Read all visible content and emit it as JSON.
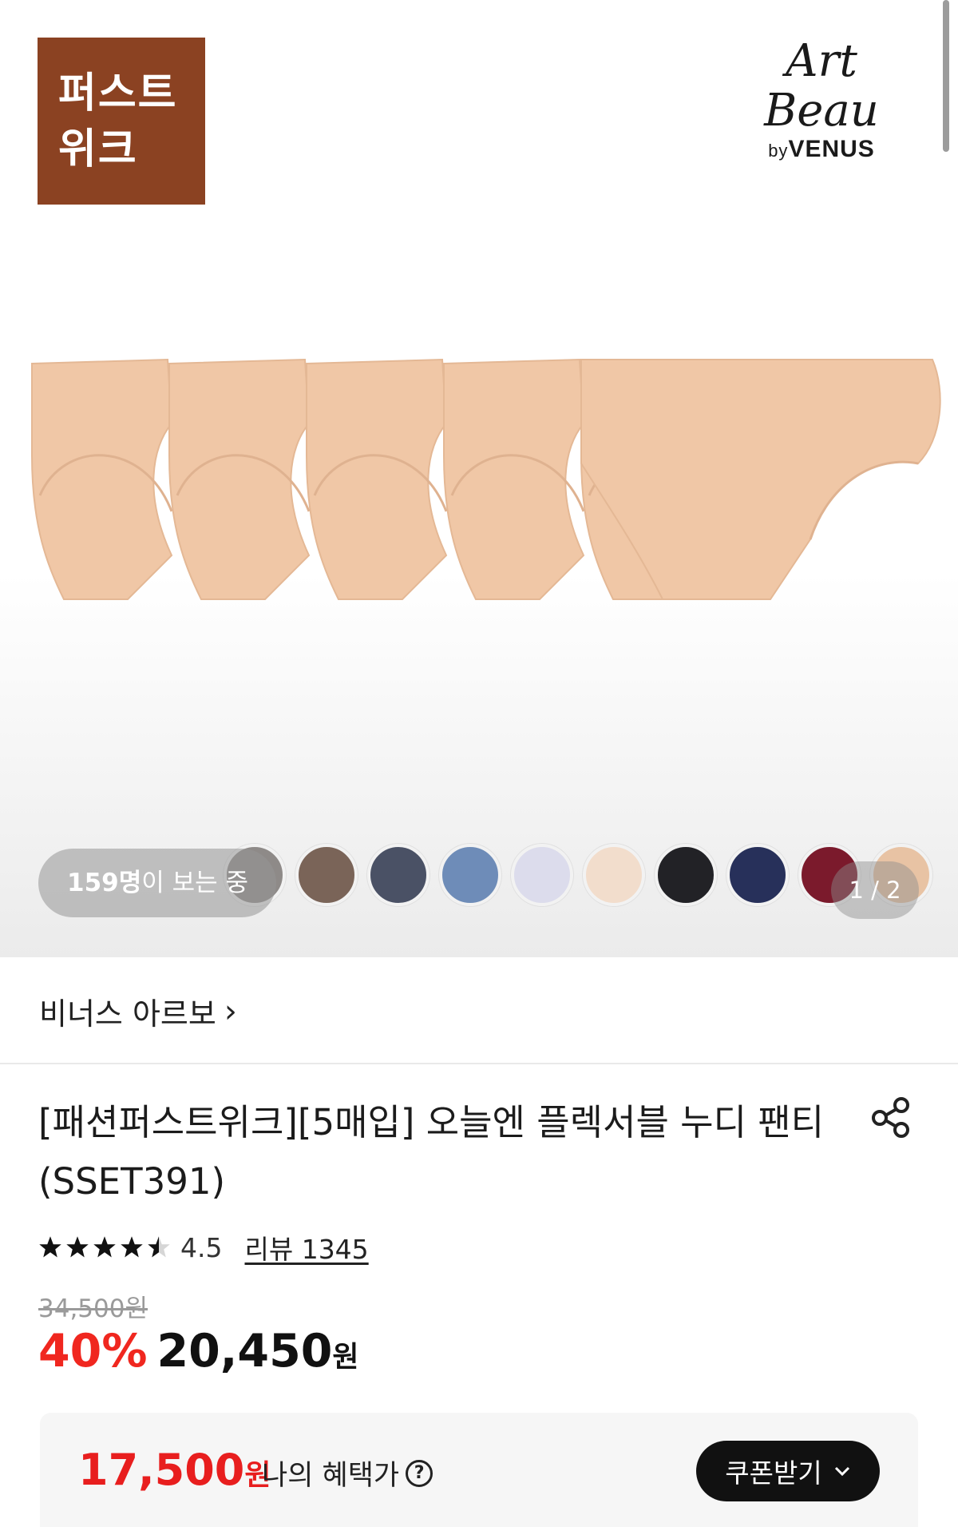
{
  "hero": {
    "badge_line1": "퍼스트",
    "badge_line2": "위크",
    "brand_main": "Art Beau",
    "brand_sub_prefix": "by",
    "brand_sub": "VENUS",
    "viewers_count": "159명",
    "viewers_suffix": "이 보는 중",
    "pager": "1 / 2",
    "product_color": "#f0c7a6"
  },
  "swatch_colors": [
    "#8e8a88",
    "#7a6458",
    "#4a5165",
    "#6e8cb8",
    "#dcdcec",
    "#f2ddcc",
    "#222226",
    "#27305a",
    "#7b1a2c",
    "#e8c3a4"
  ],
  "seller": {
    "name": "비너스 아르보",
    "chevron": "›"
  },
  "product": {
    "title": "[패션퍼스트위크][5매입] 오늘엔 플렉서블 누디 팬티(SSET391)",
    "rating": "4.5",
    "rating_value": 4.5,
    "review_label": "리뷰 1345",
    "original_price": "34,500원",
    "discount": "40%",
    "sale_price": "20,450",
    "sale_unit": "원"
  },
  "benefit": {
    "price": "17,500",
    "unit": "원",
    "label": "나의 혜택가",
    "help": "?",
    "coupon_button": "쿠폰받기"
  },
  "colors": {
    "accent_red": "#f0271f",
    "badge_brown": "#8b4222"
  }
}
